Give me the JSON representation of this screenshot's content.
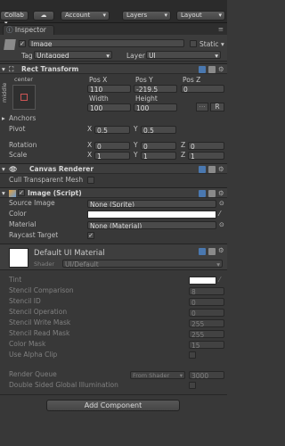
{
  "toolbar": {
    "collab": "Collab",
    "account": "Account",
    "layers": "Layers",
    "layout": "Layout"
  },
  "tab": {
    "title": "Inspector"
  },
  "object": {
    "name": "Image",
    "static_label": "Static",
    "tag_label": "Tag",
    "tag_value": "Untagged",
    "layer_label": "Layer",
    "layer_value": "UI"
  },
  "rect": {
    "title": "Rect Transform",
    "anchor_top": "center",
    "anchor_side": "middle",
    "posx_label": "Pos X",
    "posy_label": "Pos Y",
    "posz_label": "Pos Z",
    "posx": "110",
    "posy": "-219.5",
    "posz": "0",
    "width_label": "Width",
    "height_label": "Height",
    "width": "100",
    "height": "100",
    "r_label": "R",
    "anchors": "Anchors",
    "pivot": "Pivot",
    "rotation": "Rotation",
    "scale": "Scale",
    "x": "X",
    "y": "Y",
    "z": "Z",
    "pivot_x": "0.5",
    "pivot_y": "0.5",
    "rot_x": "0",
    "rot_y": "0",
    "rot_z": "0",
    "scale_x": "1",
    "scale_y": "1",
    "scale_z": "1"
  },
  "canvas_renderer": {
    "title": "Canvas Renderer",
    "cull_label": "Cull Transparent Mesh"
  },
  "image_script": {
    "title": "Image (Script)",
    "source_label": "Source Image",
    "source_value": "None (Sprite)",
    "color_label": "Color",
    "material_label": "Material",
    "material_value": "None (Material)",
    "raycast_label": "Raycast Target"
  },
  "material": {
    "title": "Default UI Material",
    "shader_label": "Shader",
    "shader_value": "UI/Default",
    "props": [
      {
        "label": "Tint",
        "value": ""
      },
      {
        "label": "Stencil Comparison",
        "value": "8"
      },
      {
        "label": "Stencil ID",
        "value": "0"
      },
      {
        "label": "Stencil Operation",
        "value": "0"
      },
      {
        "label": "Stencil Write Mask",
        "value": "255"
      },
      {
        "label": "Stencil Read Mask",
        "value": "255"
      },
      {
        "label": "Color Mask",
        "value": "15"
      },
      {
        "label": "Use Alpha Clip",
        "value": ""
      }
    ],
    "render_queue_label": "Render Queue",
    "render_queue_mode": "From Shader",
    "render_queue_value": "3000",
    "double_sided_label": "Double Sided Global Illumination"
  },
  "add_component": "Add Component",
  "colors": {
    "background": "#383838",
    "header": "#3e3e3e",
    "field": "#4a4a4a",
    "accent": "#3d6fb0"
  }
}
